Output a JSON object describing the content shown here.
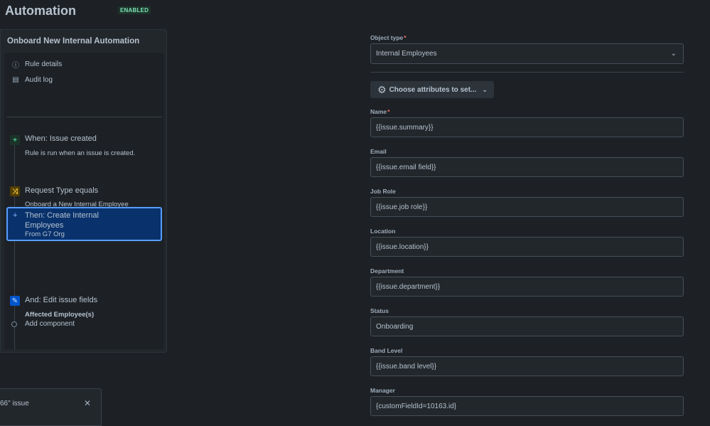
{
  "header": {
    "title": "Automation",
    "status_badge": "ENABLED"
  },
  "rule": {
    "name": "Onboard New Internal Automation",
    "meta": [
      {
        "label": "Rule details",
        "icon": "info-icon"
      },
      {
        "label": "Audit log",
        "icon": "document-icon"
      }
    ],
    "steps": [
      {
        "title": "When: Issue created",
        "subtitle": "Rule is run when an issue is created.",
        "icon": "plus-icon"
      },
      {
        "title": "Request Type equals",
        "subtitle": "Onboard a New Internal Employee",
        "icon": "shuffle-icon"
      },
      {
        "title": "Then: Create Internal Employees",
        "subtitle": "From G7 Org",
        "icon": "plus-icon",
        "selected": true
      },
      {
        "title": "And: Edit issue fields",
        "subtitle": "Affected Employee(s)",
        "icon": "pencil-icon"
      }
    ],
    "add_component": "Add component"
  },
  "toast": {
    "message": "66\" issue"
  },
  "form": {
    "object_type": {
      "label": "Object type",
      "value": "Internal Employees"
    },
    "choose_attributes": "Choose attributes to set...",
    "fields": [
      {
        "label": "Name",
        "value": "{{issue.summary}}",
        "required": true
      },
      {
        "label": "Email",
        "value": "{{issue.email field}}"
      },
      {
        "label": "Job Role",
        "value": "{{issue.job role}}"
      },
      {
        "label": "Location",
        "value": "{{issue.location}}"
      },
      {
        "label": "Department",
        "value": "{{issue.department}}"
      },
      {
        "label": "Status",
        "value": "Onboarding"
      },
      {
        "label": "Band Level",
        "value": "{{issue.band level}}"
      },
      {
        "label": "Manager",
        "value": "{customFieldId=10163.id}"
      }
    ]
  },
  "colors": {
    "accent": "#579dff",
    "selected_bg": "#09326c",
    "enabled_badge": "#7ee2b8"
  }
}
